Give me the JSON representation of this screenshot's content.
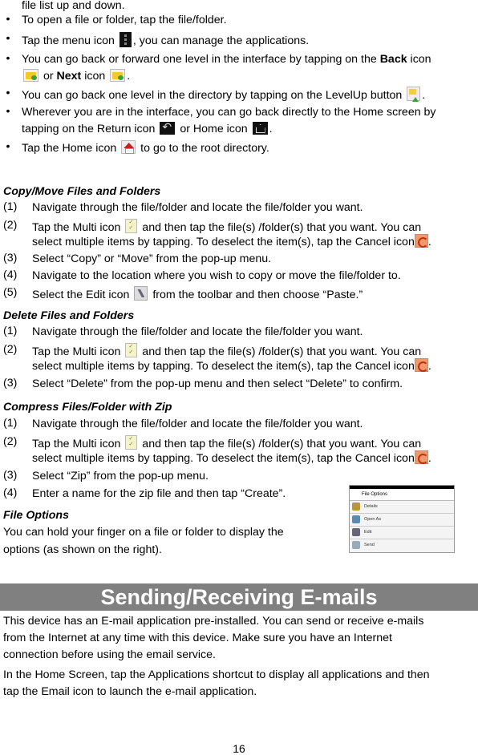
{
  "intro": {
    "continued_line": "file list up and down.",
    "bullets": [
      {
        "text": "To open a file or folder, tap the file/folder."
      },
      {
        "pre": "Tap the menu icon ",
        "icon": "menu-icon",
        "post": ", you can manage the applications."
      },
      {
        "line1": "You can go back or forward one level in the interface by tapping on the ",
        "bold1": "Back",
        "line1_post": " icon",
        "or_text": " or ",
        "bold2": "Next",
        "icon_word": " icon "
      },
      {
        "pre": "You can go back one level in the directory by tapping on the LevelUp button ",
        "post": "."
      },
      {
        "line1": "Wherever you are in the interface, you can go back directly to the Home screen by",
        "line2_pre": "tapping on the Return icon ",
        "line2_mid": " or Home icon ",
        "line2_post": "."
      },
      {
        "pre": "Tap the Home icon ",
        "post": " to go to the root directory."
      }
    ]
  },
  "sections": {
    "copy_move": {
      "title": "Copy/Move Files and Folders",
      "steps": [
        {
          "num": "(1)",
          "text": "Navigate through the file/folder and locate the file/folder you want."
        },
        {
          "num": "(2)",
          "pre": "Tap the Multi icon ",
          "post": " and then tap the file(s) /folder(s) that you want. You can",
          "line2": "select multiple items by tapping. To deselect the item(s), tap the Cancel icon",
          "line2_post": "."
        },
        {
          "num": "(3)",
          "text": "Select “Copy” or “Move” from the pop-up menu."
        },
        {
          "num": "(4)",
          "text": "Navigate to the location where you wish to copy or move the file/folder to."
        },
        {
          "num": "(5)",
          "pre": "Select the Edit icon ",
          "post": " from the toolbar and then choose “Paste.”"
        }
      ]
    },
    "delete": {
      "title": "Delete Files and Folders",
      "steps": [
        {
          "num": "(1)",
          "text": "Navigate through the file/folder and locate the file/folder you want."
        },
        {
          "num": "(2)",
          "pre": "Tap the Multi icon ",
          "post": " and then tap the file(s) /folder(s) that you want. You can",
          "line2": "select multiple items by tapping. To deselect the item(s), tap the Cancel icon",
          "line2_post": "."
        },
        {
          "num": "(3)",
          "text": "Select “Delete” from the pop-up menu and then select “Delete” to confirm."
        }
      ]
    },
    "compress": {
      "title": "Compress Files/Folder with Zip",
      "steps": [
        {
          "num": "(1)",
          "text": "Navigate through the file/folder and locate the file/folder you want."
        },
        {
          "num": "(2)",
          "pre": "Tap the Multi icon ",
          "post": " and then tap the file(s) /folder(s) that you want. You can",
          "line2": "select multiple items by tapping. To deselect the item(s), tap the Cancel icon",
          "line2_post": "."
        },
        {
          "num": "(3)",
          "text": "Select “Zip” from the pop-up menu."
        },
        {
          "num": "(4)",
          "text": "Enter a name for the zip file and then tap “Create”."
        }
      ]
    },
    "file_options": {
      "title": "File Options",
      "line1": "You can hold your finger on a file or folder to display the",
      "line2": "options (as shown on the right)."
    }
  },
  "popup": {
    "title": "File Options",
    "items": [
      "Details",
      "Open As",
      "Edit",
      "Send"
    ]
  },
  "email": {
    "banner": "Sending/Receiving E-mails",
    "para1": [
      "This device has an E-mail application pre-installed. You can send or receive e-mails",
      "from the Internet at any time with this device. Make sure you have an Internet",
      "connection before using the email service."
    ],
    "para2": [
      "In the Home Screen, tap the Applications shortcut to display all applications and then",
      "tap the Email icon to launch the e-mail application."
    ]
  },
  "page_number": "16"
}
